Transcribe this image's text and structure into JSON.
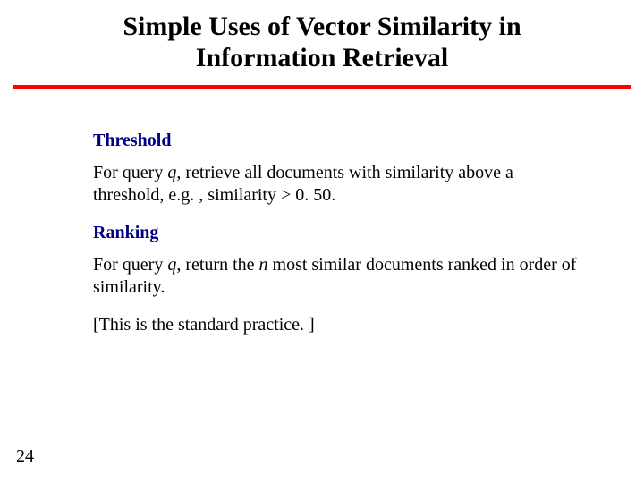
{
  "title_line1": "Simple Uses of Vector Similarity in",
  "title_line2": "Information Retrieval",
  "section1_heading": "Threshold",
  "section1_prefix": "For query ",
  "section1_q": "q",
  "section1_suffix": ", retrieve all documents with similarity above a threshold, e.g. , similarity > 0. 50.",
  "section2_heading": "Ranking",
  "section2_prefix": "For query ",
  "section2_q": "q",
  "section2_mid": ", return the ",
  "section2_n": "n",
  "section2_suffix": " most similar documents ranked in order of similarity.",
  "note": "[This is the standard practice. ]",
  "page_number": "24",
  "colors": {
    "accent_rule": "#ff0000",
    "heading": "#000080"
  }
}
